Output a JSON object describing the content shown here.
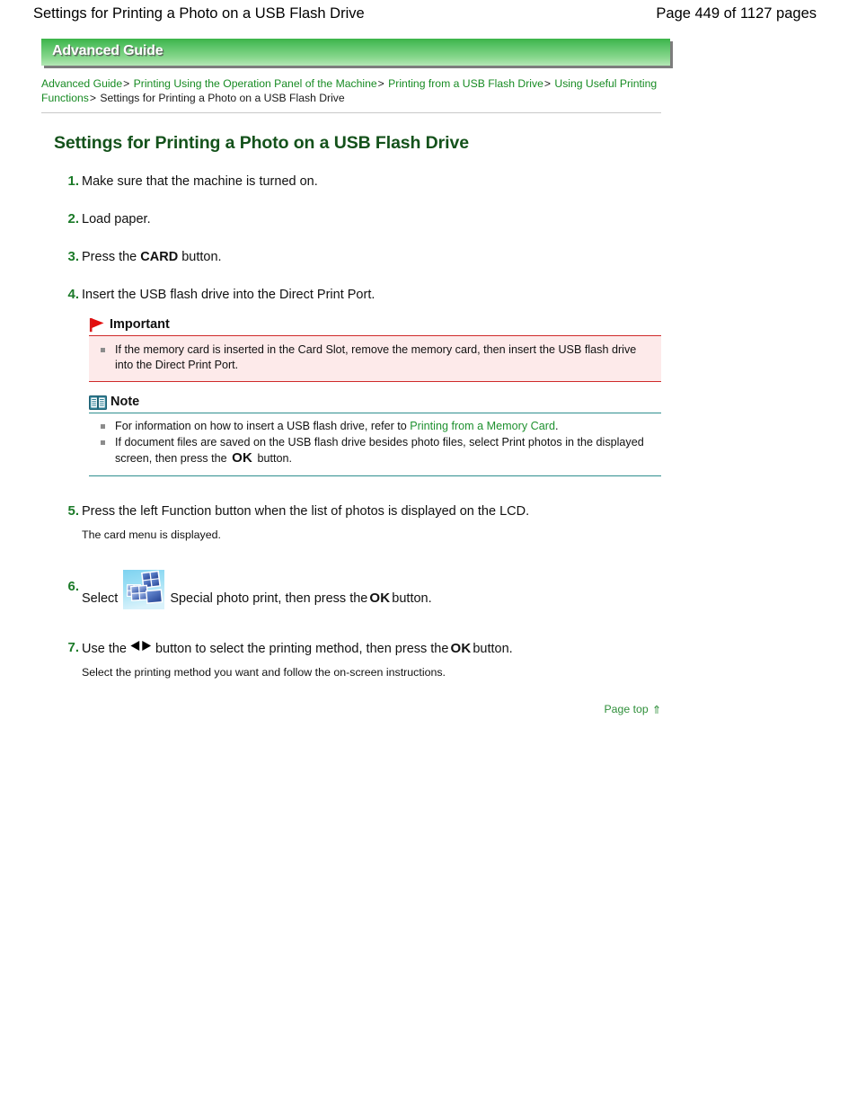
{
  "header": {
    "doc_title": "Settings for Printing a Photo on a USB Flash Drive",
    "page_count": "Page 449 of 1127 pages"
  },
  "banner": {
    "label": "Advanced Guide",
    "gradient_top": "#3cb449",
    "gradient_bottom": "#b4e8b6"
  },
  "breadcrumb": {
    "items": [
      {
        "label": "Advanced Guide",
        "link": true
      },
      {
        "label": "Printing Using the Operation Panel of the Machine",
        "link": true
      },
      {
        "label": "Printing from a USB Flash Drive",
        "link": true
      },
      {
        "label": "Using Useful Printing Functions",
        "link": true
      },
      {
        "label": "Settings for Printing a Photo on a USB Flash Drive",
        "link": false
      }
    ],
    "separator": ">",
    "link_color": "#178b23"
  },
  "title": "Settings for Printing a Photo on a USB Flash Drive",
  "steps": [
    {
      "num": "1.",
      "text": "Make sure that the machine is turned on."
    },
    {
      "num": "2.",
      "text": "Load paper."
    },
    {
      "num": "3.",
      "text_before": "Press the ",
      "key": "CARD",
      "text_after": " button."
    },
    {
      "num": "4.",
      "text": "Insert the USB flash drive into the Direct Print Port."
    },
    {
      "num": "5.",
      "text": "Press the left Function button when the list of photos is displayed on the LCD.",
      "sub": "The card menu is displayed."
    },
    {
      "num": "6.",
      "text_before": "Select",
      "text_mid": "Special photo print, then press the",
      "ok_key": "OK",
      "text_after": "button."
    },
    {
      "num": "7.",
      "text_before": "Use the",
      "text_mid": "button to select the printing method, then press the",
      "ok_key": "OK",
      "text_after": "button.",
      "sub": "Select the printing method you want and follow the on-screen instructions."
    }
  ],
  "important": {
    "heading": "Important",
    "icon": "red-flag-icon",
    "accent_color": "#cf2a2a",
    "background": "#fdeaea",
    "items": [
      "If the memory card is inserted in the Card Slot, remove the memory card, then insert the USB flash drive into the Direct Print Port."
    ]
  },
  "note": {
    "heading": "Note",
    "icon": "open-book-icon",
    "accent_color": "#2f8f8f",
    "items": [
      {
        "text_before": "For information on how to insert a USB flash drive, refer to ",
        "link": "Printing from a Memory Card",
        "text_after": "."
      },
      {
        "text_before": "If document files are saved on the USB flash drive besides photo files, select Print photos in the displayed screen, then press the ",
        "key": "OK",
        "text_after": " button."
      }
    ]
  },
  "footer": {
    "page_top_label": "Page top",
    "page_top_arrow": "⇑"
  }
}
